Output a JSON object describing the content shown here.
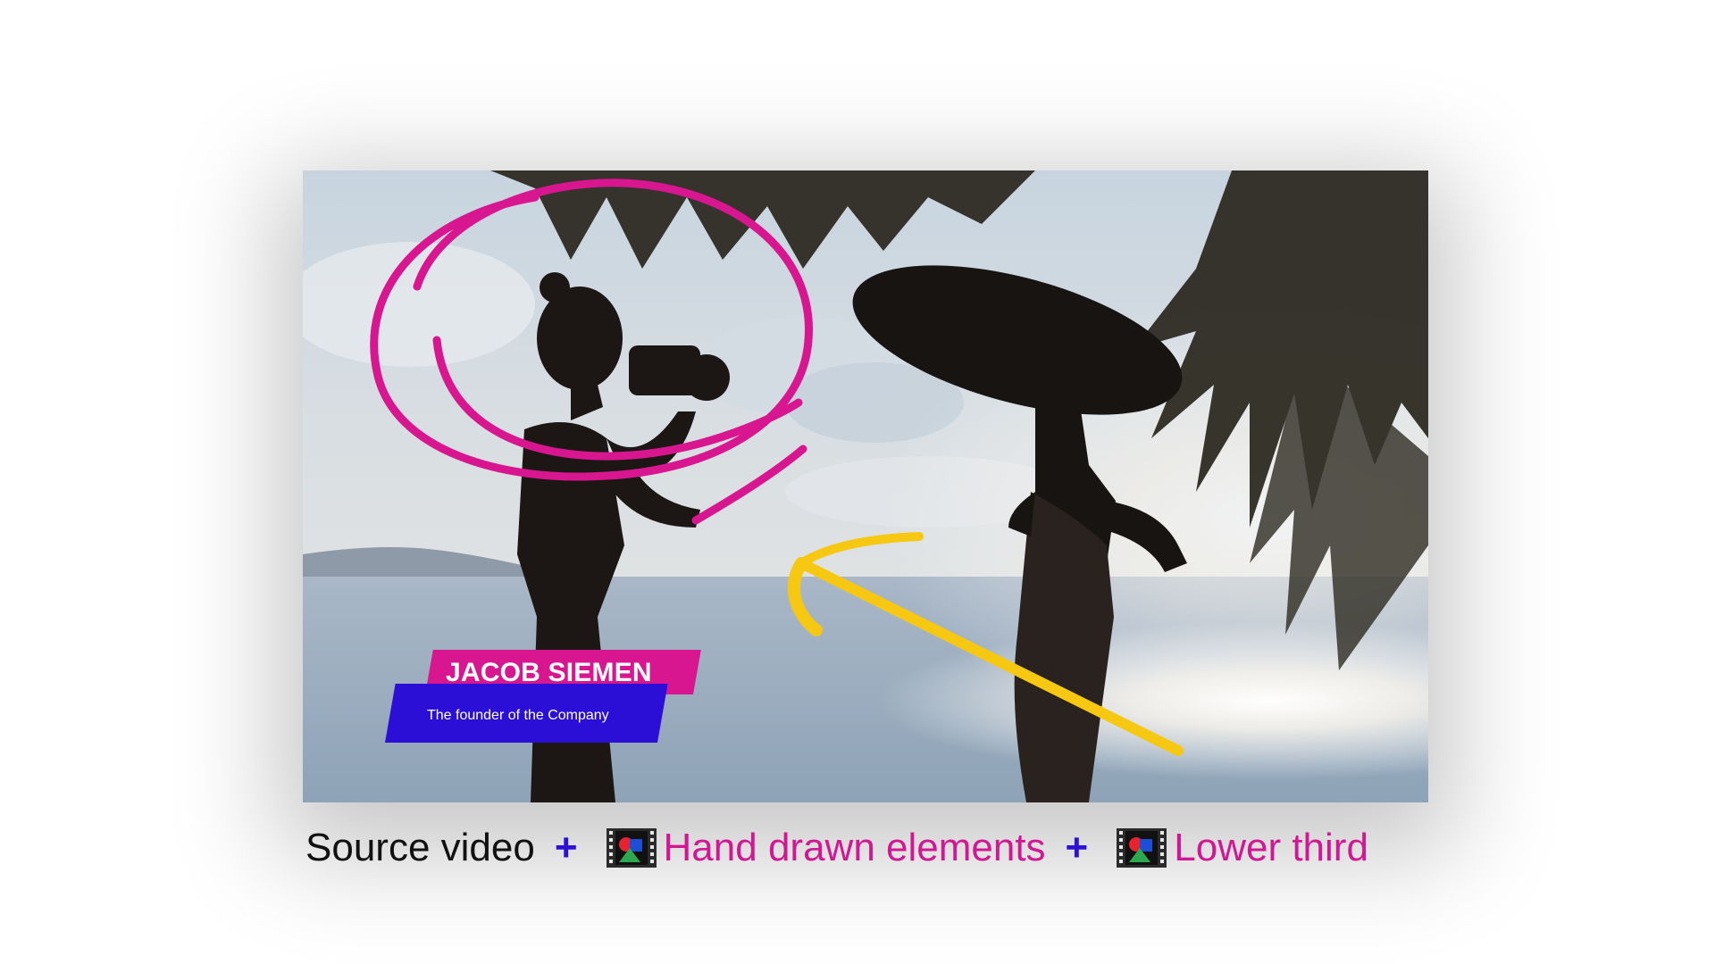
{
  "lower_third": {
    "name": "JACOB SIEMEN",
    "title": "The founder of the Company"
  },
  "caption": {
    "source": "Source video",
    "plus": "+",
    "hand_drawn": "Hand drawn elements",
    "lower_third": "Lower third",
    "icons": [
      "film-clip-icon",
      "film-clip-icon"
    ]
  },
  "colors": {
    "pink_accent": "#d8168f",
    "blue_accent": "#2b0fd6",
    "arrow_yellow": "#f7c812",
    "caption_pink": "#d21793",
    "plus_blue": "#2b10d6"
  }
}
